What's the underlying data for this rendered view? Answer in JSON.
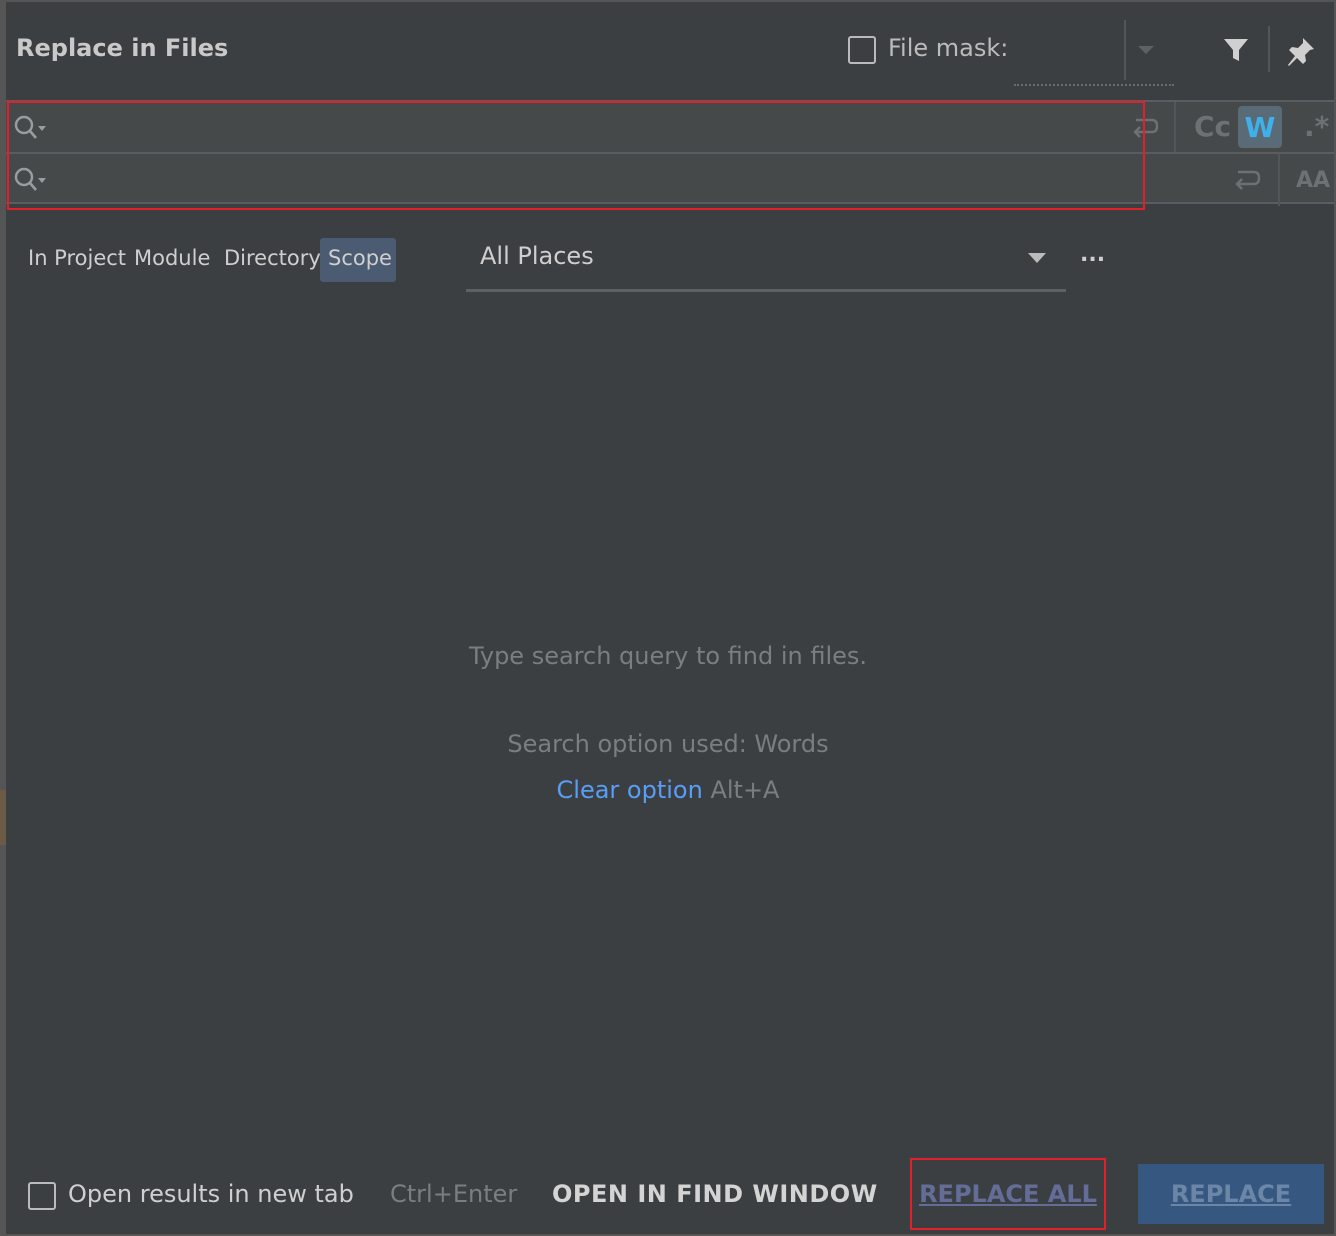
{
  "header": {
    "title": "Replace in Files",
    "file_mask_label": "File mask:",
    "file_mask_checked": false
  },
  "search": {
    "search_value": "",
    "replace_value": "",
    "match_case_label": "Cc",
    "words_label": "W",
    "regex_label": ".*",
    "preserve_case_label": "AA"
  },
  "scope": {
    "tabs": [
      "In Project",
      "Module",
      "Directory",
      "Scope"
    ],
    "active_tab": "Scope",
    "selected": "All Places",
    "more_label": "..."
  },
  "main": {
    "empty_message": "Type search query to find in files.",
    "option_message": "Search option used: Words",
    "clear_option_link": "Clear option",
    "clear_option_shortcut": "Alt+A"
  },
  "footer": {
    "open_new_tab_label": "Open results in new tab",
    "open_new_tab_checked": false,
    "shortcut": "Ctrl+Enter",
    "open_find_window": "OPEN IN FIND WINDOW",
    "replace_all": "REPLACE ALL",
    "replace": "REPLACE"
  },
  "colors": {
    "background": "#3c3f41",
    "field_background": "#45494a",
    "highlight": "#e0202a",
    "active_tab": "#4b5b72",
    "link": "#589df6",
    "primary_button": "#365880"
  },
  "icons": [
    "search-icon",
    "filter-icon",
    "pin-icon",
    "newline-icon",
    "chevron-down-icon"
  ]
}
